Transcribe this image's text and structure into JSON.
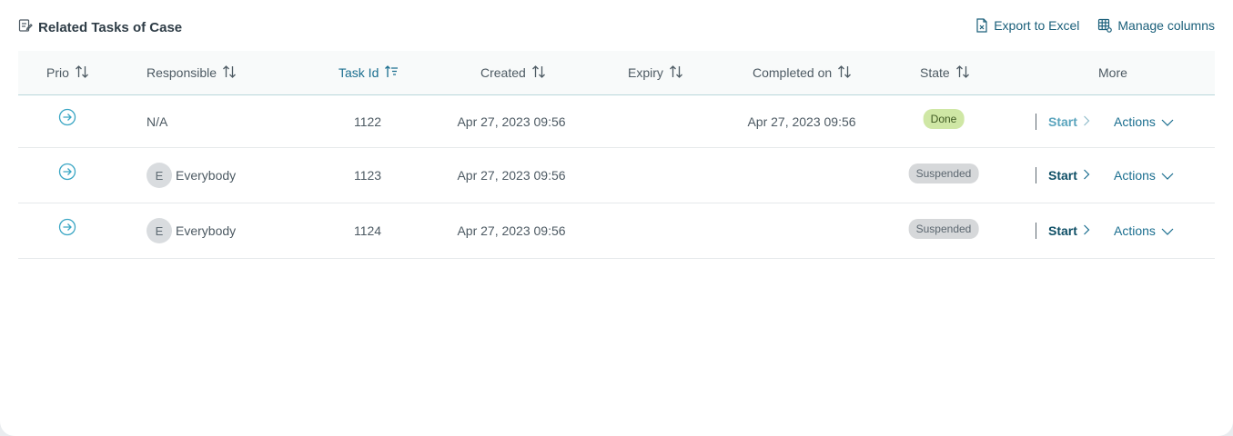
{
  "header": {
    "title": "Related Tasks of Case",
    "export_label": "Export to Excel",
    "manage_label": "Manage columns"
  },
  "columns": {
    "prio": "Prio",
    "responsible": "Responsible",
    "task_id": "Task Id",
    "created": "Created",
    "expiry": "Expiry",
    "completed_on": "Completed on",
    "state": "State",
    "more": "More"
  },
  "rows": [
    {
      "responsible": "N/A",
      "avatar": "",
      "task_id": "1122",
      "created": "Apr 27, 2023 09:56",
      "expiry": "",
      "completed_on": "Apr 27, 2023 09:56",
      "state": "Done",
      "start_label": "Start",
      "actions_label": "Actions"
    },
    {
      "responsible": "Everybody",
      "avatar": "E",
      "task_id": "1123",
      "created": "Apr 27, 2023 09:56",
      "expiry": "",
      "completed_on": "",
      "state": "Suspended",
      "start_label": "Start",
      "actions_label": "Actions"
    },
    {
      "responsible": "Everybody",
      "avatar": "E",
      "task_id": "1124",
      "created": "Apr 27, 2023 09:56",
      "expiry": "",
      "completed_on": "",
      "state": "Suspended",
      "start_label": "Start",
      "actions_label": "Actions"
    }
  ],
  "colors": {
    "accent": "#1a6e8f",
    "done_badge": "#cfe7a5",
    "suspended_badge": "#d6d8da",
    "prio_icon": "#3aa6c4"
  }
}
